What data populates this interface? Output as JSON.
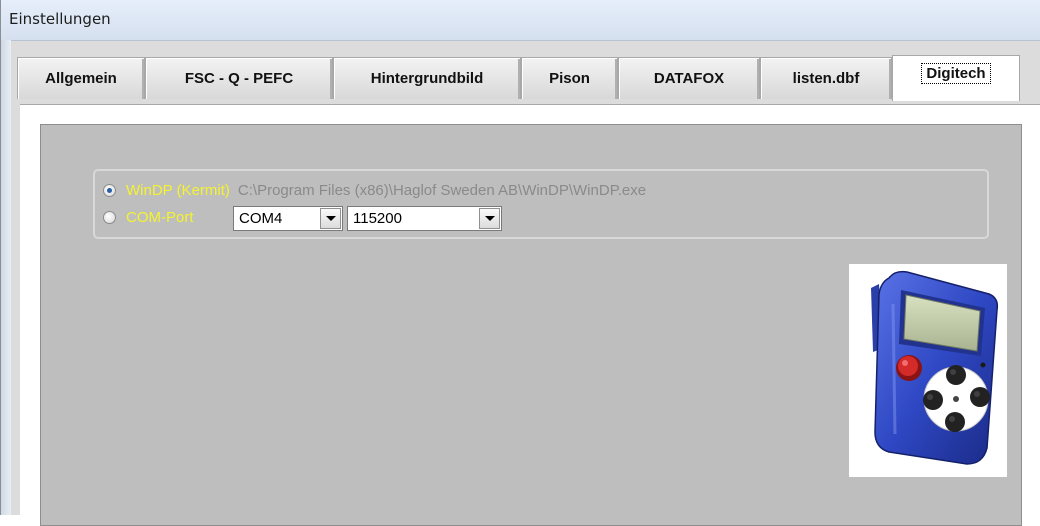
{
  "window": {
    "title": "Einstellungen"
  },
  "tabs": [
    {
      "label": "Allgemein",
      "active": false
    },
    {
      "label": "FSC - Q - PEFC",
      "active": false
    },
    {
      "label": "Hintergrundbild",
      "active": false
    },
    {
      "label": "Pison",
      "active": false
    },
    {
      "label": "DATAFOX",
      "active": false
    },
    {
      "label": "listen.dbf",
      "active": false
    },
    {
      "label": "Digitech",
      "active": true
    }
  ],
  "digitech": {
    "option_windp": {
      "label": "WinDP (Kermit)",
      "checked": true,
      "path": "C:\\Program Files (x86)\\Haglof Sweden AB\\WinDP\\WinDP.exe"
    },
    "option_comport": {
      "label": "COM-Port",
      "checked": false
    },
    "com_port": {
      "value": "COM4"
    },
    "baud_rate": {
      "value": "115200"
    },
    "device_image": "digitech-caliper-device"
  },
  "colors": {
    "label_yellow": "#f5f32e",
    "panel_gray": "#bebebe",
    "path_gray": "#8a8a8a",
    "device_blue": "#2f48c4"
  }
}
